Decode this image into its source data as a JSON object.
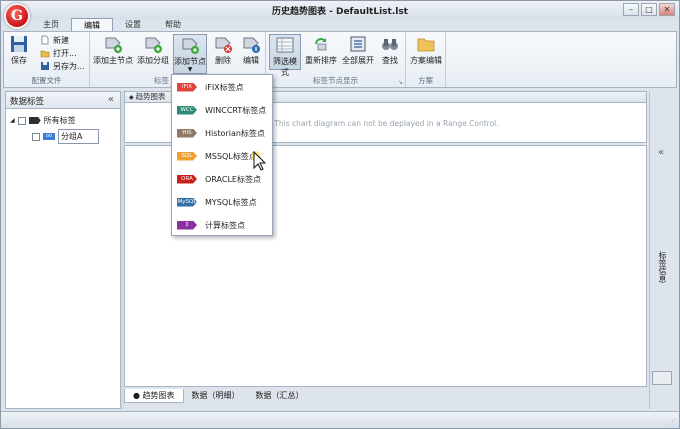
{
  "window": {
    "title": "历史趋势图表 - DefaultList.lst",
    "logo_letter": "G",
    "controls": [
      "–",
      "□",
      "✕"
    ]
  },
  "tabs": [
    {
      "label": "主页",
      "active": false
    },
    {
      "label": "编辑",
      "active": true
    },
    {
      "label": "设置",
      "active": false
    },
    {
      "label": "帮助",
      "active": false
    }
  ],
  "ribbon": {
    "groups": {
      "config": "配置文件",
      "tags": "标签",
      "display": "标签节点显示",
      "scheme": "方案"
    },
    "buttons": {
      "save": "保存",
      "new": "新建",
      "open": "打开...",
      "save_as": "另存为...",
      "add_main": "添加主节点",
      "add_group": "添加分组",
      "add_node": "添加节点",
      "delete": "删除",
      "edit": "编辑",
      "filter_mode": "筛选模式",
      "resort": "重新排序",
      "expand_all": "全部展开",
      "find": "查找",
      "scheme_edit": "方案编辑"
    }
  },
  "left_panel": {
    "title": "数据标签",
    "collapse_glyph": "«",
    "tree": [
      {
        "label": "所有标签",
        "level": 0,
        "badge": ""
      },
      {
        "label": "分组A",
        "level": 1,
        "badge": "oo"
      }
    ]
  },
  "center": {
    "range_title": "趋势图表",
    "range_message": "This chart diagram can not be deplayed in a Range Control.",
    "bottom_tabs": [
      {
        "label": "● 趋势图表",
        "active": true
      },
      {
        "label": "数据（明细）",
        "active": false
      },
      {
        "label": "数据（汇总）",
        "active": false
      }
    ]
  },
  "right_panel": {
    "collapse_glyph": "«",
    "label": "标签信息"
  },
  "dropdown": {
    "items": [
      {
        "badge": "iFIX",
        "label": "iFIX标签点",
        "color": "#e0453a"
      },
      {
        "badge": "WCC",
        "label": "WINCCRT标签点",
        "color": "#2f8a78"
      },
      {
        "badge": "HIS",
        "label": "Historian标签点",
        "color": "#8f7a66"
      },
      {
        "badge": "SQL",
        "label": "MSSQL标签点",
        "color": "#f0a030"
      },
      {
        "badge": "ORA",
        "label": "ORACLE标签点",
        "color": "#c8201a"
      },
      {
        "badge": "MySQL",
        "label": "MYSQL标签点",
        "color": "#2f6fa6"
      },
      {
        "badge": "Σ",
        "label": "计算标签点",
        "color": "#8b2fa0"
      }
    ]
  },
  "colors": {
    "ribbon_bg": "#eef3f9",
    "frame": "#dde4ec",
    "accent": "#c8101a"
  }
}
